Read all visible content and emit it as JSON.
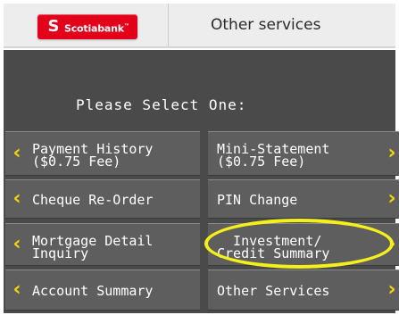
{
  "header": {
    "logo_mark": "S",
    "logo_text": "Scotiabank",
    "logo_tm": "™",
    "title": "Other services"
  },
  "prompt": "Please Select One:",
  "buttons": {
    "payment_history": {
      "line1": "Payment History",
      "line2": "($0.75 Fee)"
    },
    "mini_statement": {
      "line1": "Mini-Statement",
      "line2": "($0.75 Fee)"
    },
    "cheque_reorder": {
      "line1": "Cheque Re-Order"
    },
    "pin_change": {
      "line1": "PIN Change"
    },
    "mortgage_detail": {
      "line1": "Mortgage Detail",
      "line2": "Inquiry"
    },
    "investment_credit": {
      "line1": "  Investment/",
      "line2": "Credit Summary"
    },
    "account_summary": {
      "line1": "Account Summary"
    },
    "other_services": {
      "line1": "Other Services"
    }
  },
  "colors": {
    "brand_red": "#e2001a",
    "panel_gray": "#4a4a4a",
    "button_gray": "#5e5e5e",
    "arrow_yellow": "#f5d800",
    "highlight_yellow": "#f5ef1a"
  },
  "icons": {
    "left_arrow": "chevron-left-icon",
    "right_arrow": "chevron-right-icon",
    "logo": "scotiabank-s-icon"
  }
}
